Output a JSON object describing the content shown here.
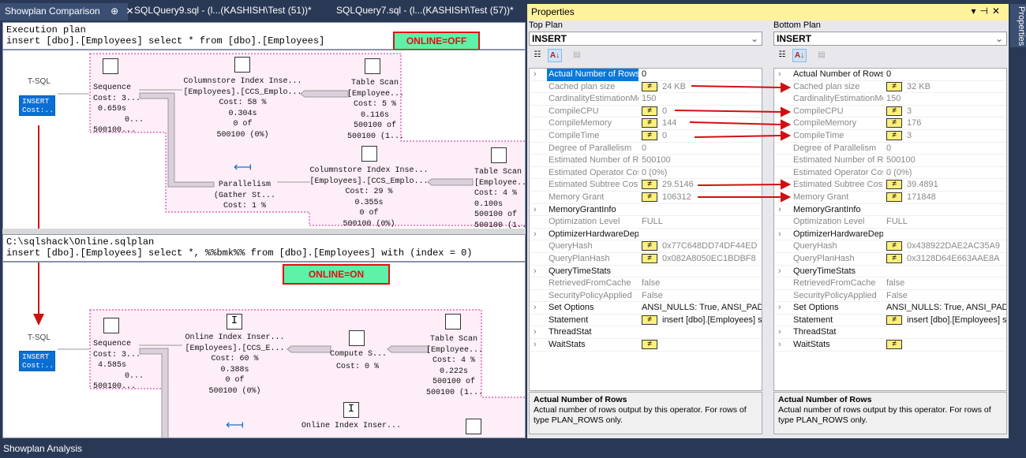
{
  "tabs": [
    {
      "label": "Showplan Comparison",
      "active": true
    },
    {
      "label": "SQLQuery9.sql - (l...(KASHISH\\Test (51))*"
    },
    {
      "label": "SQLQuery7.sql - (l...(KASHISH\\Test (57))*"
    }
  ],
  "tab_icons": {
    "pin": "⊕",
    "close": "✕"
  },
  "top_plan": {
    "header_line1": "Execution plan",
    "header_line2": "insert [dbo].[Employees] select * from [dbo].[Employees]",
    "badge": "ONLINE=OFF",
    "tsql": "T-SQL",
    "insert": [
      "INSERT",
      "Cost:..."
    ],
    "nodes": {
      "sequence": [
        "Sequence",
        "Cost: 3...",
        "0.659s",
        "0...",
        "500100..."
      ],
      "cs_insert": [
        "Columnstore Index Inse...",
        "[Employees].[CCS_Emplo...",
        "Cost: 58 %",
        "0.304s",
        "0 of",
        "500100 (0%)"
      ],
      "table_scan": [
        "Table Scan",
        "[Employee...",
        "Cost: 5 %",
        "0.116s",
        "500100 of",
        "500100 (1..."
      ],
      "parallelism": [
        "Parallelism",
        "(Gather St...",
        "Cost: 1 %"
      ],
      "cs_insert2": [
        "Columnstore Index Inse...",
        "[Employees].[CCS_Emplo...",
        "Cost: 29 %",
        "0.355s",
        "0 of",
        "500100 (0%)"
      ],
      "table_scan2": [
        "Table Scan",
        "[Employee...",
        "Cost: 4 %",
        "0.100s",
        "500100 of",
        "500100 (1..."
      ]
    }
  },
  "bottom_plan": {
    "header_line1": "C:\\sqlshack\\Online.sqlplan",
    "header_line2": "insert [dbo].[Employees] select *, %%bmk%% from [dbo].[Employees] with (index = 0)",
    "badge": "ONLINE=ON",
    "tsql": "T-SQL",
    "insert": [
      "INSERT",
      "Cost:..."
    ],
    "nodes": {
      "sequence": [
        "Sequence",
        "Cost: 3...",
        "4.585s",
        "0...",
        "500100..."
      ],
      "online_insert": [
        "Online Index Inser...",
        "[Employees].[CCS_E...",
        "Cost: 60 %",
        "0.388s",
        "0 of",
        "500100 (0%)"
      ],
      "compute": [
        "Compute S...",
        "Cost: 0 %"
      ],
      "table_scan": [
        "Table Scan",
        "[Employee...",
        "Cost: 4 %",
        "0.222s",
        "500100 of",
        "500100 (1..."
      ],
      "online_insert2": [
        "Online Index Inser..."
      ]
    }
  },
  "properties": {
    "title": "Properties",
    "title_buttons": [
      "▾",
      "⊣",
      "✕"
    ],
    "side_tab": "Properties",
    "columns": [
      {
        "label": "Top Plan",
        "selected": "INSERT",
        "rows": [
          [
            "Actual Number of Rows",
            "0",
            false,
            true
          ],
          [
            "Cached plan size",
            "24 KB",
            true,
            false
          ],
          [
            "CardinalityEstimationModel",
            "150",
            false,
            false
          ],
          [
            "CompileCPU",
            "0",
            true,
            false
          ],
          [
            "CompileMemory",
            "144",
            true,
            false
          ],
          [
            "CompileTime",
            "0",
            true,
            false
          ],
          [
            "Degree of Parallelism",
            "0",
            false,
            false
          ],
          [
            "Estimated Number of Rows",
            "500100",
            false,
            false
          ],
          [
            "Estimated Operator Cost",
            "0 (0%)",
            false,
            false
          ],
          [
            "Estimated Subtree Cost",
            "29.5146",
            true,
            false
          ],
          [
            "Memory Grant",
            "106312",
            true,
            false
          ],
          [
            "MemoryGrantInfo",
            "",
            false,
            true
          ],
          [
            "Optimization Level",
            "FULL",
            false,
            false
          ],
          [
            "OptimizerHardwareDependentProperties",
            "",
            false,
            true
          ],
          [
            "QueryHash",
            "0x77C648DD74DF44ED",
            true,
            false
          ],
          [
            "QueryPlanHash",
            "0x082A8050EC1BDBF8",
            true,
            false
          ],
          [
            "QueryTimeStats",
            "",
            false,
            true
          ],
          [
            "RetrievedFromCache",
            "false",
            false,
            false
          ],
          [
            "SecurityPolicyApplied",
            "False",
            false,
            false
          ],
          [
            "Set Options",
            "ANSI_NULLS: True, ANSI_PADDING",
            false,
            true
          ],
          [
            "Statement",
            "insert [dbo].[Employees] select",
            true,
            "nonexp"
          ],
          [
            "ThreadStat",
            "",
            false,
            true
          ],
          [
            "WaitStats",
            "",
            true,
            true
          ]
        ],
        "desc_title": "Actual Number of Rows",
        "desc_text": "Actual number of rows output by this operator. For rows of type PLAN_ROWS only."
      },
      {
        "label": "Bottom Plan",
        "selected": "INSERT",
        "rows": [
          [
            "Actual Number of Rows",
            "0",
            false,
            true
          ],
          [
            "Cached plan size",
            "32 KB",
            true,
            false
          ],
          [
            "CardinalityEstimationModel",
            "150",
            false,
            false
          ],
          [
            "CompileCPU",
            "3",
            true,
            false
          ],
          [
            "CompileMemory",
            "176",
            true,
            false
          ],
          [
            "CompileTime",
            "3",
            true,
            false
          ],
          [
            "Degree of Parallelism",
            "0",
            false,
            false
          ],
          [
            "Estimated Number of Rows",
            "500100",
            false,
            false
          ],
          [
            "Estimated Operator Cost",
            "0 (0%)",
            false,
            false
          ],
          [
            "Estimated Subtree Cost",
            "39.4891",
            true,
            false
          ],
          [
            "Memory Grant",
            "171848",
            true,
            false
          ],
          [
            "MemoryGrantInfo",
            "",
            false,
            true
          ],
          [
            "Optimization Level",
            "FULL",
            false,
            false
          ],
          [
            "OptimizerHardwareDependentProperties",
            "",
            false,
            true
          ],
          [
            "QueryHash",
            "0x438922DAE2AC35A9",
            true,
            false
          ],
          [
            "QueryPlanHash",
            "0x3128D64E663AAE8A",
            true,
            false
          ],
          [
            "QueryTimeStats",
            "",
            false,
            true
          ],
          [
            "RetrievedFromCache",
            "false",
            false,
            false
          ],
          [
            "SecurityPolicyApplied",
            "False",
            false,
            false
          ],
          [
            "Set Options",
            "ANSI_NULLS: True, ANSI_PADDING",
            false,
            true
          ],
          [
            "Statement",
            "insert [dbo].[Employees] select",
            true,
            "nonexp"
          ],
          [
            "ThreadStat",
            "",
            false,
            true
          ],
          [
            "WaitStats",
            "",
            true,
            true
          ]
        ],
        "desc_title": "Actual Number of Rows",
        "desc_text": "Actual number of rows output by this operator. For rows of type PLAN_ROWS only."
      }
    ]
  },
  "status": "Showplan Analysis",
  "colors": {
    "background": "#293955",
    "accent": "#0a78d7",
    "diff": "#fff07a",
    "annotation": "#e01010",
    "badge": "#5ef2a9"
  }
}
